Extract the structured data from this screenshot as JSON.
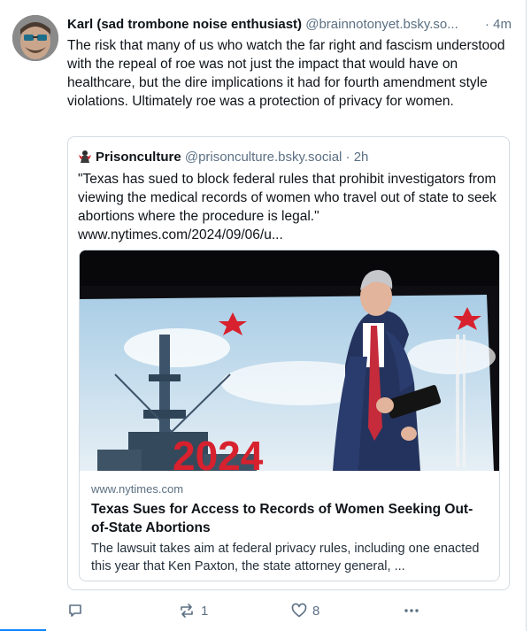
{
  "post": {
    "author_name": "Karl (sad trombone noise enthusiast)",
    "author_handle": "@brainnotonyet.bsky.so...",
    "time": "· 4m",
    "text": "The risk that many of us who watch the far right and fascism understood with the repeal of roe was not just the impact that would have on healthcare, but the dire implications it had for fourth amendment style violations.   Ultimately roe was a protection of privacy for women."
  },
  "quote": {
    "author_name": "Prisonculture",
    "author_handle": "@prisonculture.bsky.social · 2h",
    "text": "\"Texas has sued to block federal rules that prohibit investigators from viewing the medical records of women who travel out of state to seek abortions where the procedure is legal.\"",
    "link_text": "www.nytimes.com/2024/09/06/u...",
    "card": {
      "banner_text": "2024",
      "domain": "www.nytimes.com",
      "title": "Texas Sues for Access to Records of Women Seeking Out-of-State Abortions",
      "description": "The lawsuit takes aim at federal privacy rules, including one enacted this year that Ken Paxton, the state attorney general, ..."
    }
  },
  "actions": {
    "reply_count": "",
    "repost_count": "1",
    "like_count": "8"
  },
  "icons": [
    "reply-icon",
    "repost-icon",
    "like-icon",
    "more-icon"
  ],
  "colors": {
    "accent": "#1083fe",
    "muted": "#5b7083",
    "border": "#d4dbe2"
  }
}
